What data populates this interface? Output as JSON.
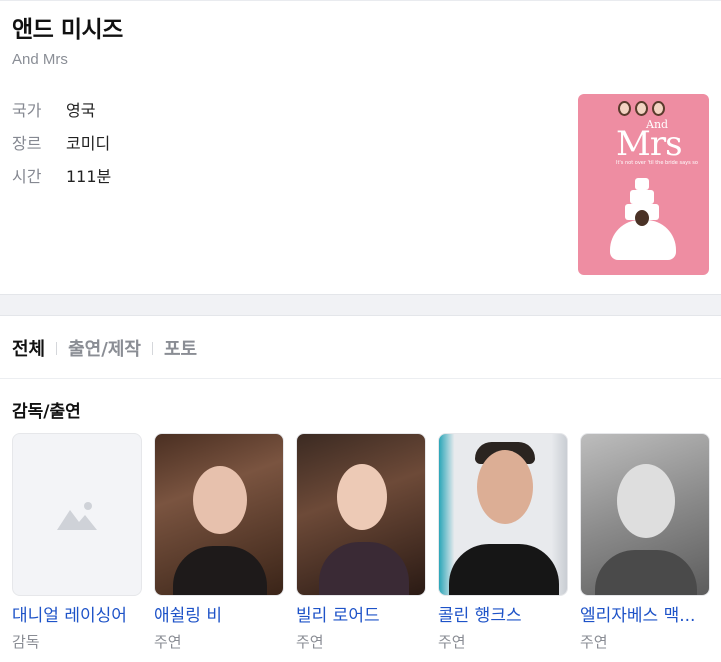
{
  "movie": {
    "title": "앤드 미시즈",
    "original_title": "And Mrs"
  },
  "info": [
    {
      "key": "국가",
      "value": "영국"
    },
    {
      "key": "장르",
      "value": "코미디"
    },
    {
      "key": "시간",
      "value": "111분"
    }
  ],
  "poster": {
    "and": "And",
    "mrs": "Mrs",
    "tagline": "It's not over 'til the bride says so",
    "color": "#ee8da2"
  },
  "tabs": [
    {
      "label": "전체",
      "active": true
    },
    {
      "label": "출연/제작",
      "active": false
    },
    {
      "label": "포토",
      "active": false
    }
  ],
  "section": {
    "title": "감독/출연"
  },
  "people": [
    {
      "name": "대니얼 레이싱어",
      "role": "감독",
      "photo": "placeholder-image-icon"
    },
    {
      "name": "애쉴링 비",
      "role": "주연",
      "photo": "portrait"
    },
    {
      "name": "빌리 로어드",
      "role": "주연",
      "photo": "portrait"
    },
    {
      "name": "콜린 행크스",
      "role": "주연",
      "photo": "portrait"
    },
    {
      "name": "엘리자베스 맥...",
      "role": "주연",
      "photo": "portrait"
    }
  ],
  "colors": {
    "link": "#1e53c8",
    "muted": "#8a8d94",
    "band": "#f1f2f5"
  }
}
